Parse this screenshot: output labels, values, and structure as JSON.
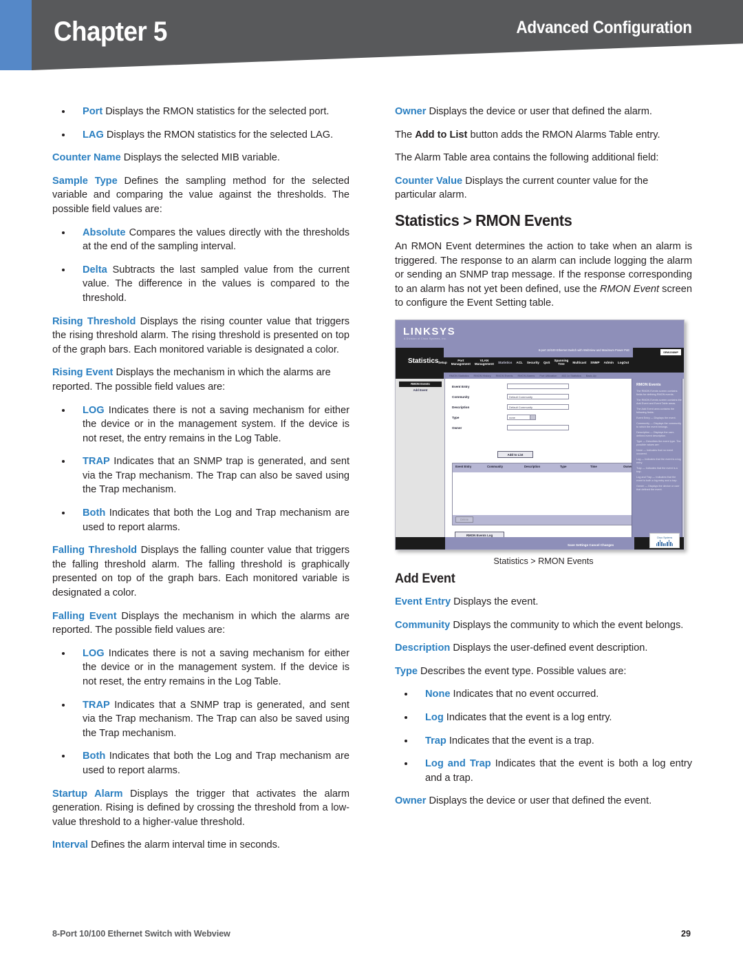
{
  "header": {
    "chapter_label": "Chapter 5",
    "section_label": "Advanced Configuration",
    "blue_accent": "#5588c8",
    "banner_color": "#58595b"
  },
  "theme": {
    "term_color": "#2a7fc1",
    "text_color": "#231f20"
  },
  "left_column": {
    "bullets_1": [
      {
        "term": "Port",
        "text": " Displays the RMON statistics for the selected port."
      },
      {
        "term": "LAG",
        "text": " Displays the RMON statistics for the selected LAG."
      }
    ],
    "p_counter_name": {
      "term": "Counter Name",
      "text": "  Displays the selected MIB variable."
    },
    "p_sample_type": {
      "term": "Sample Type",
      "text": " Defines the sampling method for the selected variable and comparing the value against the thresholds. The possible field values are:"
    },
    "bullets_2": [
      {
        "term": "Absolute",
        "text": " Compares the values directly with the thresholds at the end of the sampling interval."
      },
      {
        "term": "Delta",
        "text": " Subtracts the last sampled value from the current value. The difference in the values is compared to the threshold."
      }
    ],
    "p_rising_threshold": {
      "term": "Rising Threshold",
      "text": "  Displays the rising counter value that triggers the rising threshold alarm. The rising threshold is presented on top of the graph bars. Each monitored variable is designated a color."
    },
    "p_rising_event": {
      "term": "Rising Event",
      "text": "  Displays the mechanism in which the alarms are reported. The possible field values are:"
    },
    "bullets_3": [
      {
        "term": "LOG",
        "text": " Indicates there is not a saving mechanism for either the device or in the management system. If the device is not reset, the entry remains in the Log Table."
      },
      {
        "term": "TRAP",
        "text": "  Indicates that an SNMP trap is generated, and sent via the Trap mechanism. The Trap can also be saved using the Trap mechanism."
      },
      {
        "term": "Both",
        "text": "  Indicates that both the Log and Trap mechanism are used to report alarms."
      }
    ],
    "p_falling_threshold": {
      "term": "Falling Threshold",
      "text": "  Displays the falling counter value that triggers the falling threshold alarm. The falling threshold is graphically presented on top of the graph bars. Each monitored variable is designated a color."
    },
    "p_falling_event": {
      "term": "Falling Event",
      "text": " Displays the mechanism in which the alarms are reported. The possible field values are:"
    },
    "bullets_4": [
      {
        "term": "LOG",
        "text": " Indicates there is not a saving mechanism for either the device or in the management system. If the device is not reset, the entry remains in the Log Table."
      },
      {
        "term": "TRAP",
        "text": "  Indicates that a SNMP trap is generated, and sent via the Trap mechanism. The Trap can also be saved using the Trap mechanism."
      },
      {
        "term": "Both",
        "text": "  Indicates that both the Log and Trap mechanism are used to report alarms."
      }
    ],
    "p_startup_alarm": {
      "term": "Startup Alarm",
      "text": " Displays the trigger that activates the alarm generation. Rising is defined by crossing the threshold from a low-value threshold to a higher-value threshold."
    },
    "p_interval": {
      "term": "Interval",
      "text": "  Defines the alarm interval time in seconds."
    }
  },
  "right_column": {
    "p_owner": {
      "term": "Owner",
      "text": " Displays the device or user that defined the alarm."
    },
    "p_add_to_list": {
      "pre": "The ",
      "bold": "Add to List",
      "post": " button adds the RMON Alarms Table entry."
    },
    "p_alarm_table": "The Alarm Table area contains the following additional field:",
    "p_counter_value": {
      "term": "Counter Value",
      "text": "  Displays the current counter value for the particular alarm."
    },
    "section_heading": "Statistics > RMON Events",
    "p_intro": {
      "pre": "An RMON Event determines the action to take when an alarm is triggered. The response to an alarm can include logging the alarm or sending an SNMP trap message. If the response corresponding to an alarm has not yet been defined, use the ",
      "italic": "RMON Event",
      "post": " screen to configure the Event Setting table."
    },
    "figure_caption": "Statistics > RMON Events",
    "subsection_heading": "Add Event",
    "p_event_entry": {
      "term": "Event Entry",
      "text": "  Displays the event."
    },
    "p_community": {
      "term": "Community",
      "text": "  Displays the community to which the event belongs."
    },
    "p_description": {
      "term": "Description",
      "text": "  Displays the user-defined event description."
    },
    "p_type": {
      "term": "Type",
      "text": "  Describes the event type. Possible values are:"
    },
    "bullets_type": [
      {
        "term": "None",
        "text": "  Indicates that no event occurred."
      },
      {
        "term": "Log",
        "text": "  Indicates that the event is a log entry."
      },
      {
        "term": "Trap",
        "text": "  Indicates that the event is a trap."
      },
      {
        "term": "Log and Trap",
        "text": "  Indicates that the event is both a log entry and a trap."
      }
    ],
    "p_owner_event": {
      "term": "Owner",
      "text": " Displays the device or user that defined the event."
    }
  },
  "figure": {
    "brand": "LINKSYS",
    "brand_sub": "A Division of Cisco Systems, Inc.",
    "model_text": "8-port 10/100 Ethernet Switch with WebView and Maximum Power PoE",
    "device_badge": "SRW208MP",
    "section_title": "Statistics",
    "nav_items": [
      "Setup",
      "Port\nManagement",
      "VLAN\nManagement",
      "Statistics",
      "ACL",
      "Security",
      "QoS",
      "Spanning\nTree",
      "Multicast",
      "SNMP",
      "Admin",
      "LogOut"
    ],
    "subnav_items": [
      "RMON Statistics",
      "RMON History",
      "RMON Events",
      "RMON Alarms",
      "Port Utilization",
      "802.1x Statistics",
      "Back-Up"
    ],
    "left_nav_selected": "RMON Events",
    "left_nav_item": "Add Event",
    "form_rows": [
      {
        "label": "Event Entry",
        "value": "",
        "kind": "input"
      },
      {
        "label": "Community",
        "value": "Default Community",
        "kind": "input"
      },
      {
        "label": "Description",
        "value": "Default Community",
        "kind": "input"
      },
      {
        "label": "Type",
        "value": "none",
        "kind": "select"
      },
      {
        "label": "Owner",
        "value": "",
        "kind": "input"
      }
    ],
    "add_button": "Add to List",
    "table_headers": [
      "Event Entry",
      "Community",
      "Description",
      "Type",
      "Time",
      "Owner"
    ],
    "table_rows": [],
    "delete_button": "Delete",
    "cancel_button": "Cancel",
    "log_button": "RMON Events Log",
    "save_links": "Save Settings   Cancel Changes",
    "help_title": "RMON Events",
    "help_paragraphs": [
      "The RMON Events screen contains fields for defining RMON events.",
      "The RMON Events screen contains the Add Event and Event Table areas.",
      "The Add Event area contains the following fields:",
      "Event Entry — Displays the event.",
      "Community — Displays the community to which the event belongs.",
      "Description — Displays the user-defined event description.",
      "Type — Describes the event type. The possible values are:",
      "None — Indicates that no event occurred.",
      "Log — Indicates that the event is a log entry.",
      "Trap — Indicates that the event is a trap.",
      "Log and Trap — Indicates that the event is both a log entry and a trap.",
      "Owner — Displays the device or user that defined the event."
    ],
    "cisco_label": "Cisco Systems"
  },
  "footer": {
    "title": "8-Port 10/100 Ethernet Switch with Webview",
    "page_number": "29"
  }
}
